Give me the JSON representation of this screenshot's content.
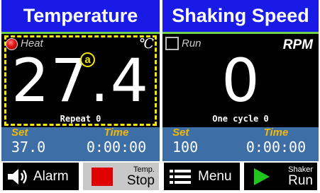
{
  "temperature": {
    "title": "Temperature",
    "indicator_label": "Heat",
    "unit": "℃",
    "marker": "a",
    "value": "27.4",
    "sub_label": "Repeat 0",
    "set_label": "Set",
    "set_value": "37.0",
    "time_label": "Time",
    "time_value": "0:00:00"
  },
  "shaking": {
    "title": "Shaking Speed",
    "indicator_label": "Run",
    "unit": "RPM",
    "value": "0",
    "sub_label": "One cycle 0",
    "set_label": "Set",
    "set_value": "100",
    "time_label": "Time",
    "time_value": "0:00:00"
  },
  "buttons": {
    "alarm": "Alarm",
    "temp_stop_top": "Temp.",
    "temp_stop_bottom": "Stop",
    "menu": "Menu",
    "shaker_run_top": "Shaker",
    "shaker_run_bottom": "Run"
  },
  "icons": {
    "alarm": "speaker-icon",
    "stop": "stop-square-icon",
    "menu": "list-menu-icon",
    "run": "play-triangle-icon"
  },
  "colors": {
    "header_bg": "#1a1ae6",
    "header_rule": "#6fd04a",
    "stats_bg": "#3d6fa6",
    "label_orange": "#f5b800",
    "dash_yellow": "#f5e60a",
    "stop_red": "#e00000",
    "run_green": "#22c41e"
  }
}
